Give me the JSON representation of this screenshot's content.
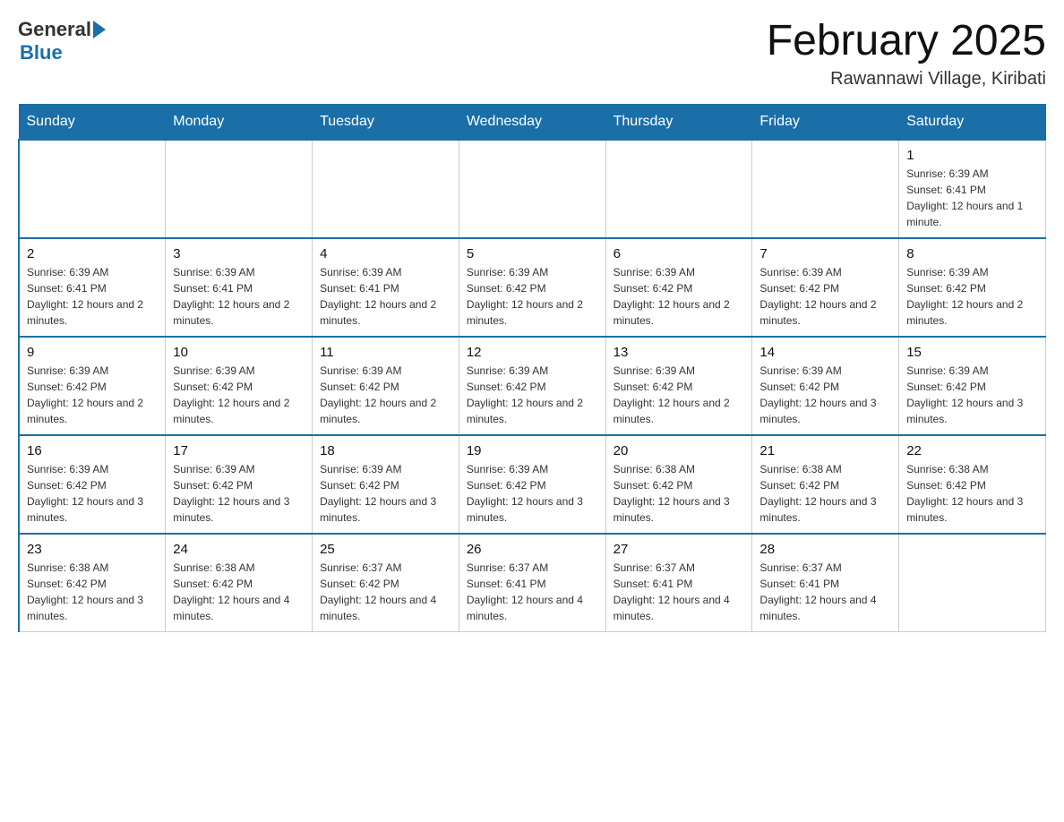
{
  "header": {
    "logo_general": "General",
    "logo_blue": "Blue",
    "title": "February 2025",
    "subtitle": "Rawannawi Village, Kiribati"
  },
  "days_of_week": [
    "Sunday",
    "Monday",
    "Tuesday",
    "Wednesday",
    "Thursday",
    "Friday",
    "Saturday"
  ],
  "weeks": [
    {
      "days": [
        {
          "number": "",
          "info": ""
        },
        {
          "number": "",
          "info": ""
        },
        {
          "number": "",
          "info": ""
        },
        {
          "number": "",
          "info": ""
        },
        {
          "number": "",
          "info": ""
        },
        {
          "number": "",
          "info": ""
        },
        {
          "number": "1",
          "info": "Sunrise: 6:39 AM\nSunset: 6:41 PM\nDaylight: 12 hours and 1 minute."
        }
      ]
    },
    {
      "days": [
        {
          "number": "2",
          "info": "Sunrise: 6:39 AM\nSunset: 6:41 PM\nDaylight: 12 hours and 2 minutes."
        },
        {
          "number": "3",
          "info": "Sunrise: 6:39 AM\nSunset: 6:41 PM\nDaylight: 12 hours and 2 minutes."
        },
        {
          "number": "4",
          "info": "Sunrise: 6:39 AM\nSunset: 6:41 PM\nDaylight: 12 hours and 2 minutes."
        },
        {
          "number": "5",
          "info": "Sunrise: 6:39 AM\nSunset: 6:42 PM\nDaylight: 12 hours and 2 minutes."
        },
        {
          "number": "6",
          "info": "Sunrise: 6:39 AM\nSunset: 6:42 PM\nDaylight: 12 hours and 2 minutes."
        },
        {
          "number": "7",
          "info": "Sunrise: 6:39 AM\nSunset: 6:42 PM\nDaylight: 12 hours and 2 minutes."
        },
        {
          "number": "8",
          "info": "Sunrise: 6:39 AM\nSunset: 6:42 PM\nDaylight: 12 hours and 2 minutes."
        }
      ]
    },
    {
      "days": [
        {
          "number": "9",
          "info": "Sunrise: 6:39 AM\nSunset: 6:42 PM\nDaylight: 12 hours and 2 minutes."
        },
        {
          "number": "10",
          "info": "Sunrise: 6:39 AM\nSunset: 6:42 PM\nDaylight: 12 hours and 2 minutes."
        },
        {
          "number": "11",
          "info": "Sunrise: 6:39 AM\nSunset: 6:42 PM\nDaylight: 12 hours and 2 minutes."
        },
        {
          "number": "12",
          "info": "Sunrise: 6:39 AM\nSunset: 6:42 PM\nDaylight: 12 hours and 2 minutes."
        },
        {
          "number": "13",
          "info": "Sunrise: 6:39 AM\nSunset: 6:42 PM\nDaylight: 12 hours and 2 minutes."
        },
        {
          "number": "14",
          "info": "Sunrise: 6:39 AM\nSunset: 6:42 PM\nDaylight: 12 hours and 3 minutes."
        },
        {
          "number": "15",
          "info": "Sunrise: 6:39 AM\nSunset: 6:42 PM\nDaylight: 12 hours and 3 minutes."
        }
      ]
    },
    {
      "days": [
        {
          "number": "16",
          "info": "Sunrise: 6:39 AM\nSunset: 6:42 PM\nDaylight: 12 hours and 3 minutes."
        },
        {
          "number": "17",
          "info": "Sunrise: 6:39 AM\nSunset: 6:42 PM\nDaylight: 12 hours and 3 minutes."
        },
        {
          "number": "18",
          "info": "Sunrise: 6:39 AM\nSunset: 6:42 PM\nDaylight: 12 hours and 3 minutes."
        },
        {
          "number": "19",
          "info": "Sunrise: 6:39 AM\nSunset: 6:42 PM\nDaylight: 12 hours and 3 minutes."
        },
        {
          "number": "20",
          "info": "Sunrise: 6:38 AM\nSunset: 6:42 PM\nDaylight: 12 hours and 3 minutes."
        },
        {
          "number": "21",
          "info": "Sunrise: 6:38 AM\nSunset: 6:42 PM\nDaylight: 12 hours and 3 minutes."
        },
        {
          "number": "22",
          "info": "Sunrise: 6:38 AM\nSunset: 6:42 PM\nDaylight: 12 hours and 3 minutes."
        }
      ]
    },
    {
      "days": [
        {
          "number": "23",
          "info": "Sunrise: 6:38 AM\nSunset: 6:42 PM\nDaylight: 12 hours and 3 minutes."
        },
        {
          "number": "24",
          "info": "Sunrise: 6:38 AM\nSunset: 6:42 PM\nDaylight: 12 hours and 4 minutes."
        },
        {
          "number": "25",
          "info": "Sunrise: 6:37 AM\nSunset: 6:42 PM\nDaylight: 12 hours and 4 minutes."
        },
        {
          "number": "26",
          "info": "Sunrise: 6:37 AM\nSunset: 6:41 PM\nDaylight: 12 hours and 4 minutes."
        },
        {
          "number": "27",
          "info": "Sunrise: 6:37 AM\nSunset: 6:41 PM\nDaylight: 12 hours and 4 minutes."
        },
        {
          "number": "28",
          "info": "Sunrise: 6:37 AM\nSunset: 6:41 PM\nDaylight: 12 hours and 4 minutes."
        },
        {
          "number": "",
          "info": ""
        }
      ]
    }
  ]
}
